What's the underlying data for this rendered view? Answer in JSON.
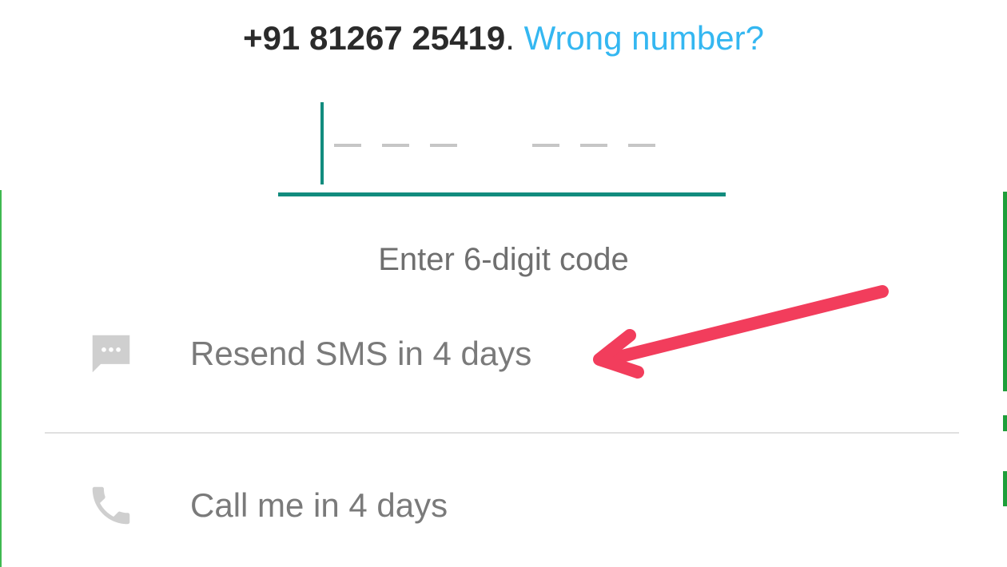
{
  "header": {
    "partial_text": "",
    "phone_number": "+91 81267 25419",
    "separator": ".",
    "wrong_number_link": "Wrong number?"
  },
  "code_input": {
    "hint": "Enter 6-digit code",
    "digits": 6
  },
  "options": {
    "resend_sms": {
      "label": "Resend SMS in 4 days",
      "icon": "sms-icon"
    },
    "call_me": {
      "label": "Call me in 4 days",
      "icon": "phone-icon"
    }
  },
  "colors": {
    "accent": "#128c7e",
    "link": "#34b7f1",
    "annotation_arrow": "#f23d5c",
    "disabled_text": "#7a7a7a"
  }
}
